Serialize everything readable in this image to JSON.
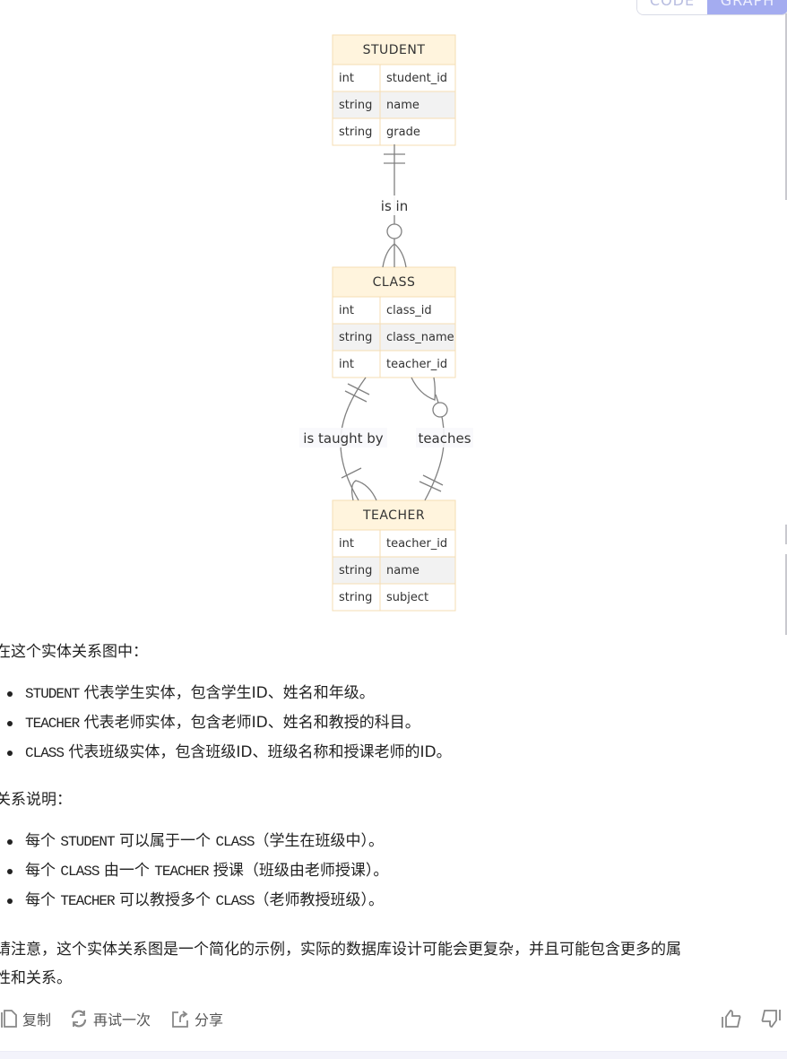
{
  "view_toggle": {
    "code_label": "CODE",
    "graph_label": "GRAPH",
    "active": "GRAPH"
  },
  "diagram": {
    "entities": [
      {
        "name": "STUDENT",
        "attributes": [
          {
            "type": "int",
            "name": "student_id"
          },
          {
            "type": "string",
            "name": "name"
          },
          {
            "type": "string",
            "name": "grade"
          }
        ]
      },
      {
        "name": "CLASS",
        "attributes": [
          {
            "type": "int",
            "name": "class_id"
          },
          {
            "type": "string",
            "name": "class_name"
          },
          {
            "type": "int",
            "name": "teacher_id"
          }
        ]
      },
      {
        "name": "TEACHER",
        "attributes": [
          {
            "type": "int",
            "name": "teacher_id"
          },
          {
            "type": "string",
            "name": "name"
          },
          {
            "type": "string",
            "name": "subject"
          }
        ]
      }
    ],
    "relationships": [
      {
        "from": "STUDENT",
        "to": "CLASS",
        "label": "is in",
        "from_card": "exactly-one",
        "to_card": "zero-or-many"
      },
      {
        "from": "CLASS",
        "to": "TEACHER",
        "label": "is taught by",
        "from_card": "exactly-one",
        "to_card": "one-or-many"
      },
      {
        "from": "TEACHER",
        "to": "CLASS",
        "label": "teaches",
        "from_card": "exactly-one",
        "to_card": "zero-or-many"
      }
    ],
    "colors": {
      "header_bg": "#fff4dd",
      "border": "#f5deb3",
      "row_alt": "#f2f2f2",
      "line": "#777777"
    }
  },
  "text": {
    "intro": "在这个实体关系图中：",
    "entity_items": [
      {
        "code": "STUDENT",
        "text": " 代表学生实体，包含学生ID、姓名和年级。"
      },
      {
        "code": "TEACHER",
        "text": " 代表老师实体，包含老师ID、姓名和教授的科目。"
      },
      {
        "code": "CLASS",
        "text": " 代表班级实体，包含班级ID、班级名称和授课老师的ID。"
      }
    ],
    "relations_title": "关系说明：",
    "relation_items": [
      {
        "p1": "每个 ",
        "c1": "STUDENT",
        "p2": " 可以属于一个 ",
        "c2": "CLASS",
        "p3": "（学生在班级中）。"
      },
      {
        "p1": "每个 ",
        "c1": "CLASS",
        "p2": " 由一个 ",
        "c2": "TEACHER",
        "p3": " 授课（班级由老师授课）。"
      },
      {
        "p1": "每个 ",
        "c1": "TEACHER",
        "p2": " 可以教授多个 ",
        "c2": "CLASS",
        "p3": "（老师教授班级）。"
      }
    ],
    "note_line1": "请注意，这个实体关系图是一个简化的示例，实际的数据库设计可能会更复杂，并且可能包含更多的属",
    "note_line2": "性和关系。"
  },
  "actions": {
    "copy": "复制",
    "retry": "再试一次",
    "share": "分享",
    "like_icon": "thumbs-up-icon",
    "dislike_icon": "thumbs-down-icon"
  }
}
